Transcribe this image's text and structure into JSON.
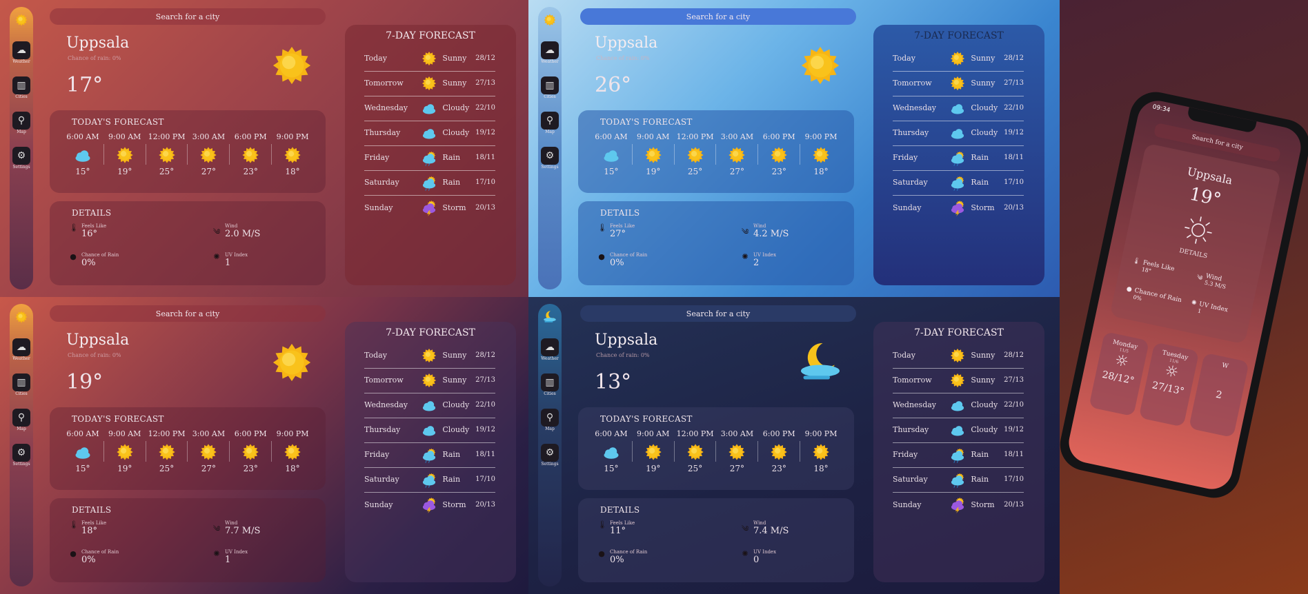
{
  "search_placeholder": "Search for a city",
  "nav": {
    "weather": "Weather",
    "cities": "Cities",
    "map": "Map",
    "settings": "Settings"
  },
  "headings": {
    "today": "TODAY'S FORECAST",
    "details": "DETAILS",
    "week": "7-DAY FORECAST"
  },
  "detail_labels": {
    "feels": "Feels Like",
    "wind": "Wind",
    "rain": "Chance of Rain",
    "uv": "UV Index"
  },
  "hours": [
    "6:00 AM",
    "9:00 AM",
    "12:00 PM",
    "3:00 AM",
    "6:00 PM",
    "9:00 PM"
  ],
  "hour_icons": [
    "cloud",
    "sun",
    "sun",
    "sun",
    "sun",
    "sun"
  ],
  "hour_temps": [
    "15°",
    "19°",
    "25°",
    "27°",
    "23°",
    "18°"
  ],
  "week": [
    {
      "day": "Today",
      "icon": "sun",
      "cond": "Sunny",
      "range": "28/12"
    },
    {
      "day": "Tomorrow",
      "icon": "sun",
      "cond": "Sunny",
      "range": "27/13"
    },
    {
      "day": "Wednesday",
      "icon": "cloud",
      "cond": "Cloudy",
      "range": "22/10"
    },
    {
      "day": "Thursday",
      "icon": "cloud",
      "cond": "Cloudy",
      "range": "19/12"
    },
    {
      "day": "Friday",
      "icon": "rain",
      "cond": "Rain",
      "range": "18/11"
    },
    {
      "day": "Saturday",
      "icon": "rain",
      "cond": "Rain",
      "range": "17/10"
    },
    {
      "day": "Sunday",
      "icon": "storm",
      "cond": "Storm",
      "range": "20/13"
    }
  ],
  "variants": [
    {
      "city": "Uppsala",
      "rain": "Chance of rain: 0%",
      "temp": "17°",
      "main_icon": "sun",
      "rail_icon": "sun",
      "feels": "16°",
      "wind": "2.0 M/S",
      "rain_pct": "0%",
      "uv": "1"
    },
    {
      "city": "Uppsala",
      "rain": "Chance of rain: 0%",
      "temp": "26°",
      "main_icon": "sun",
      "rail_icon": "sun",
      "feels": "27°",
      "wind": "4.2 M/S",
      "rain_pct": "0%",
      "uv": "2"
    },
    {
      "city": "Uppsala",
      "rain": "Chance of rain: 0%",
      "temp": "19°",
      "main_icon": "sun",
      "rail_icon": "sun",
      "feels": "18°",
      "wind": "7.7 M/S",
      "rain_pct": "0%",
      "uv": "1"
    },
    {
      "city": "Uppsala",
      "rain": "Chance of rain: 0%",
      "temp": "13°",
      "main_icon": "moon",
      "rail_icon": "moon",
      "feels": "11°",
      "wind": "7.4 M/S",
      "rain_pct": "0%",
      "uv": "0"
    }
  ],
  "phone": {
    "time": "09:34",
    "city": "Uppsala",
    "temp": "19°",
    "details": "DETAILS",
    "feels_label": "Feels Like",
    "feels": "18°",
    "wind_label": "Wind",
    "wind": "5.3 M/S",
    "rain_label": "Chance of Rain",
    "rain": "0%",
    "uv_label": "UV Index",
    "uv": "1",
    "days": [
      {
        "name": "Monday",
        "date": "11/5",
        "temps": "28/12°"
      },
      {
        "name": "Tuesday",
        "date": "11/6",
        "temps": "27/13°"
      },
      {
        "name": "W",
        "date": "",
        "temps": "2"
      }
    ]
  },
  "colors": {
    "sun": "#f7b514",
    "cloud": "#5ec8ee",
    "storm": "#8a3fd0"
  }
}
